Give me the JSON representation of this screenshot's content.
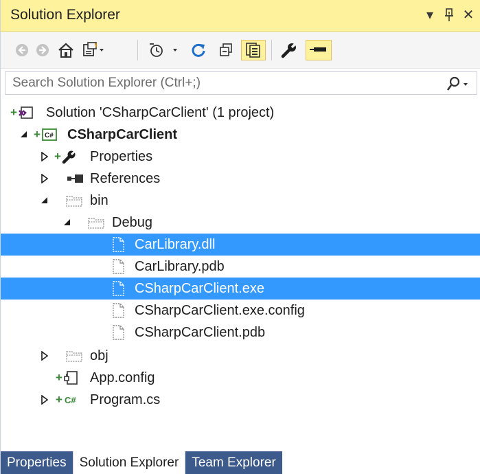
{
  "title_bar": {
    "title": "Solution Explorer",
    "dropdown_glyph": "▾",
    "pin_glyph": "⊥",
    "close_glyph": "✕"
  },
  "toolbar": {
    "items": [
      "back-icon",
      "forward-icon",
      "home-icon",
      "switch-views-icon",
      "dropdown-arrow",
      "pending-changes-filter-icon",
      "dropdown-arrow",
      "sync-icon",
      "collapse-all-icon",
      "show-all-files-icon",
      "properties-icon",
      "preview-selected-icon"
    ],
    "active_items": [
      "show-all-files-icon",
      "preview-selected-icon"
    ]
  },
  "search": {
    "placeholder": "Search Solution Explorer (Ctrl+;)"
  },
  "tree": {
    "solution": {
      "label": "Solution 'CSharpCarClient' (1 project)"
    },
    "project": {
      "label": "CSharpCarClient"
    },
    "properties": {
      "label": "Properties"
    },
    "references": {
      "label": "References"
    },
    "bin": {
      "label": "bin"
    },
    "debug": {
      "label": "Debug"
    },
    "files": [
      {
        "label": "CarLibrary.dll",
        "selected": true
      },
      {
        "label": "CarLibrary.pdb",
        "selected": false
      },
      {
        "label": "CSharpCarClient.exe",
        "selected": true
      },
      {
        "label": "CSharpCarClient.exe.config",
        "selected": false
      },
      {
        "label": "CSharpCarClient.pdb",
        "selected": false
      }
    ],
    "obj": {
      "label": "obj"
    },
    "app_config": {
      "label": "App.config"
    },
    "program": {
      "label": "Program.cs"
    }
  },
  "bottom_tabs": [
    {
      "label": "Properties",
      "active": false
    },
    {
      "label": "Solution Explorer",
      "active": true
    },
    {
      "label": "Team Explorer",
      "active": false
    }
  ],
  "colors": {
    "title_bar_bg": "#fff29d",
    "selection_bg": "#3399ff",
    "tab_inactive_bg": "#3c5a8c",
    "plus_green": "#388a34",
    "vs_purple": "#68217a"
  }
}
